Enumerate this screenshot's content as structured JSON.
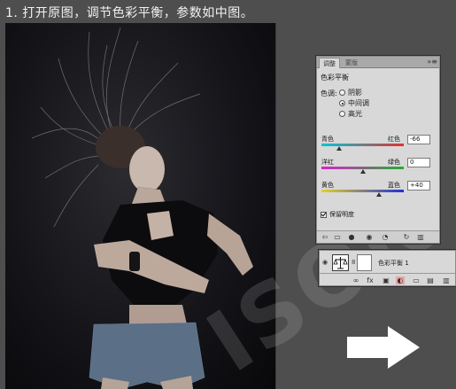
{
  "instruction": "1. 打开原图，调节色彩平衡，参数如中图。",
  "watermark": "ISON",
  "adjustments_panel": {
    "tabs": [
      "调整",
      "蒙版"
    ],
    "title": "色彩平衡",
    "tone_label": "色调:",
    "tone_options": [
      {
        "label": "阴影",
        "selected": false
      },
      {
        "label": "中间调",
        "selected": true
      },
      {
        "label": "高光",
        "selected": false
      }
    ],
    "sliders": [
      {
        "left": "青色",
        "right": "红色",
        "value": "-66",
        "fraction": 0.21,
        "gradient": [
          "#00c8d8",
          "#e03030"
        ]
      },
      {
        "left": "洋红",
        "right": "绿色",
        "value": "0",
        "fraction": 0.5,
        "gradient": [
          "#e020c8",
          "#20b030"
        ]
      },
      {
        "left": "黄色",
        "right": "蓝色",
        "value": "+40",
        "fraction": 0.7,
        "gradient": [
          "#e8d020",
          "#2030d8"
        ]
      }
    ],
    "preserve_luminosity": {
      "label": "保留明度",
      "checked": true
    }
  },
  "layers_panel": {
    "layer_name": "色彩平衡 1"
  },
  "colors": {
    "background": "#4e4e4e",
    "panel_bg": "#d8d8d8",
    "arrow": "#ffffff"
  }
}
